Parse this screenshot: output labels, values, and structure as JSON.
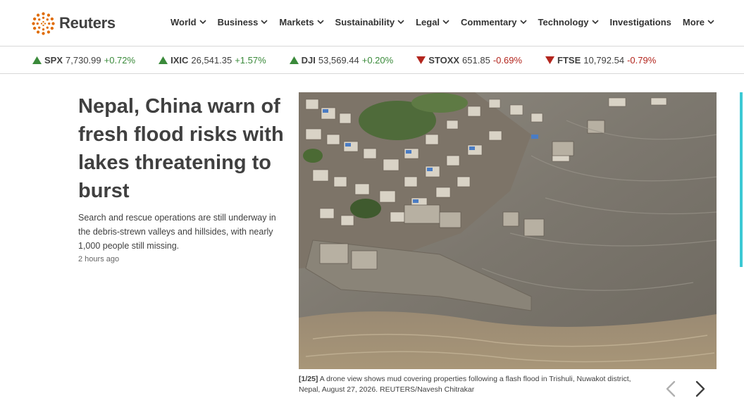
{
  "brand": {
    "name": "Reuters",
    "logo_icon": "reuters-dots-logo",
    "accent": "#e06b00"
  },
  "nav": {
    "items": [
      {
        "label": "World",
        "dropdown": true
      },
      {
        "label": "Business",
        "dropdown": true
      },
      {
        "label": "Markets",
        "dropdown": true
      },
      {
        "label": "Sustainability",
        "dropdown": true
      },
      {
        "label": "Legal",
        "dropdown": true
      },
      {
        "label": "Commentary",
        "dropdown": true
      },
      {
        "label": "Technology",
        "dropdown": true
      },
      {
        "label": "Investigations",
        "dropdown": false
      },
      {
        "label": "More",
        "dropdown": true
      }
    ]
  },
  "ticker": {
    "up_color": "#3a8a3a",
    "down_color": "#b3261e",
    "items": [
      {
        "symbol": "SPX",
        "value": "7,730.99",
        "change": "+0.72%",
        "direction": "up"
      },
      {
        "symbol": "IXIC",
        "value": "26,541.35",
        "change": "+1.57%",
        "direction": "up"
      },
      {
        "symbol": "DJI",
        "value": "53,569.44",
        "change": "+0.20%",
        "direction": "up"
      },
      {
        "symbol": "STOXX",
        "value": "651.85",
        "change": "-0.69%",
        "direction": "down"
      },
      {
        "symbol": "FTSE",
        "value": "10,792.54",
        "change": "-0.79%",
        "direction": "down"
      }
    ]
  },
  "story": {
    "headline": "Nepal, China warn of fresh flood risks with lakes threatening to burst",
    "summary": "Search and rescue operations are still underway in the debris-strewn valleys and hillsides, with nearly 1,000 people still missing.",
    "time": "2 hours ago"
  },
  "photo": {
    "counter": "[1/25]",
    "caption": " A drone view shows mud covering properties following a flash flood in Trishuli, Nuwakot district, Nepal, August 27, 2026. REUTERS/Navesh Chitrakar"
  },
  "gallery_controls": {
    "prev_icon": "chevron-left-icon",
    "next_icon": "chevron-right-icon"
  }
}
